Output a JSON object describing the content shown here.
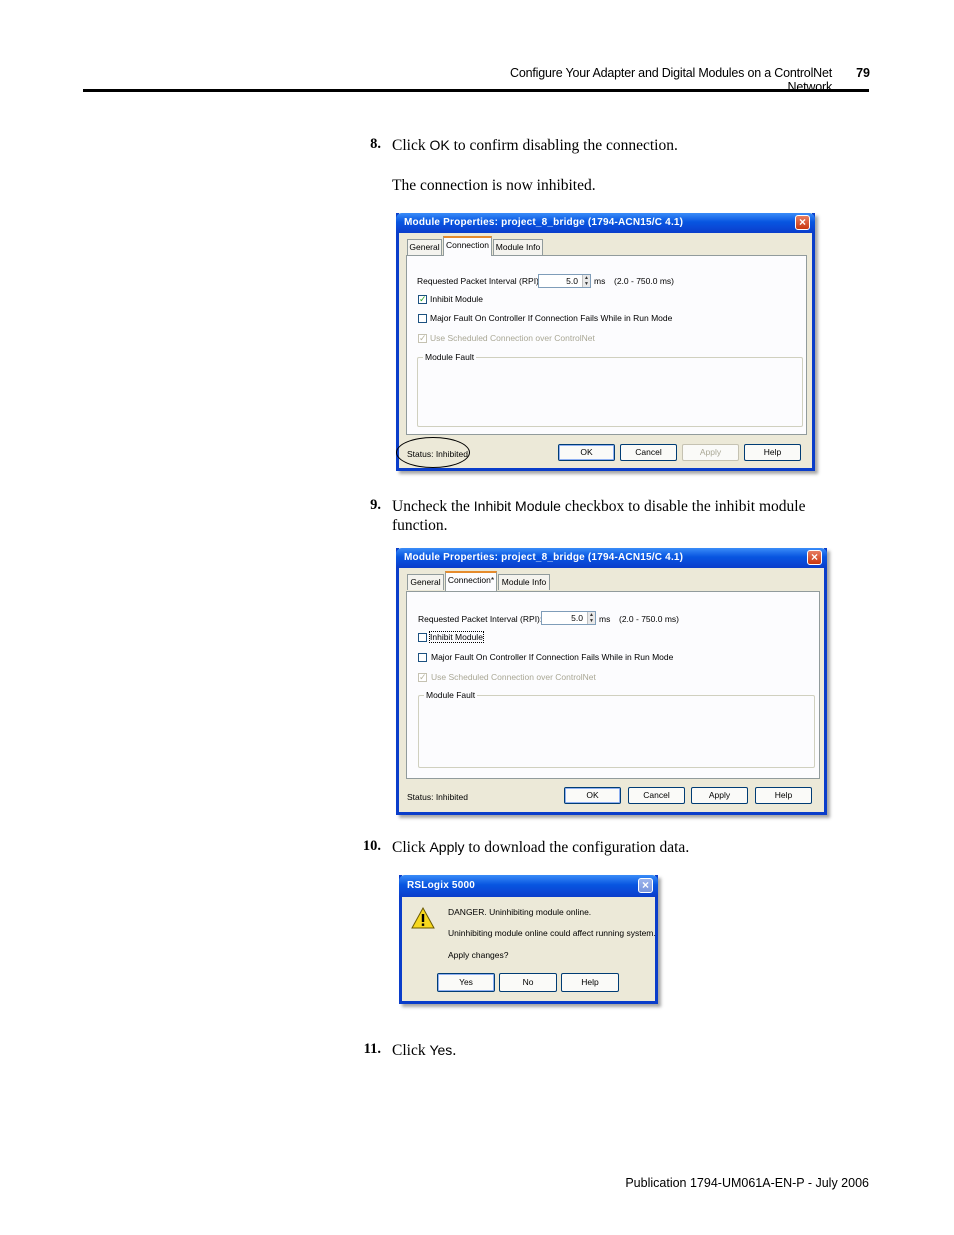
{
  "header": {
    "title": "Configure Your Adapter and Digital Modules on a ControlNet Network",
    "page": "79"
  },
  "steps": [
    {
      "num": "8.",
      "pre": "Click ",
      "kw": "OK",
      "post": " to confirm disabling the connection.",
      "note": "The connection is now inhibited."
    },
    {
      "num": "9.",
      "pre": "Uncheck the ",
      "kw": "Inhibit Module",
      "post": " checkbox to disable the inhibit module",
      "post2": "function."
    },
    {
      "num": "10.",
      "pre": "Click ",
      "kw": "Apply",
      "post": " to download the configuration data."
    },
    {
      "num": "11.",
      "pre": "Click ",
      "kw": "Yes",
      "post": "."
    }
  ],
  "dialog1": {
    "title": "Module Properties: project_8_bridge (1794-ACN15/C 4.1)",
    "tabs": [
      "General",
      "Connection",
      "Module Info"
    ],
    "rpi_label": "Requested Packet Interval (RPI):",
    "rpi_value": "5.0",
    "rpi_unit": "ms",
    "rpi_range": "(2.0 - 750.0 ms)",
    "inhibit_label": "Inhibit Module",
    "inhibit_checked": true,
    "major_fault_label": "Major Fault On Controller If Connection Fails While in Run Mode",
    "scheduled_label": "Use Scheduled Connection over ControlNet",
    "module_fault_label": "Module Fault",
    "status": "Status:  Inhibited",
    "buttons": [
      "OK",
      "Cancel",
      "Apply",
      "Help"
    ]
  },
  "dialog2": {
    "title": "Module Properties: project_8_bridge (1794-ACN15/C 4.1)",
    "tabs": [
      "General",
      "Connection*",
      "Module Info"
    ],
    "rpi_label": "Requested Packet Interval (RPI):",
    "rpi_value": "5.0",
    "rpi_unit": "ms",
    "rpi_range": "(2.0 - 750.0 ms)",
    "inhibit_label": "Inhibit Module",
    "inhibit_checked": false,
    "major_fault_label": "Major Fault On Controller If Connection Fails While in Run Mode",
    "scheduled_label": "Use Scheduled Connection over ControlNet",
    "module_fault_label": "Module Fault",
    "status": "Status:  Inhibited",
    "buttons": [
      "OK",
      "Cancel",
      "Apply",
      "Help"
    ]
  },
  "dialog3": {
    "title": "RSLogix 5000",
    "line1": "DANGER. Uninhibiting module online.",
    "line2": "Uninhibiting module online could affect running system.",
    "line3": "Apply changes?",
    "buttons": [
      "Yes",
      "No",
      "Help"
    ],
    "icon": "warning-icon"
  },
  "colors": {
    "titlebar": "#0a3dca",
    "window_bg": "#ece9d8",
    "tab_highlight": "#e68b2c"
  },
  "footer": "Publication 1794-UM061A-EN-P - July 2006"
}
